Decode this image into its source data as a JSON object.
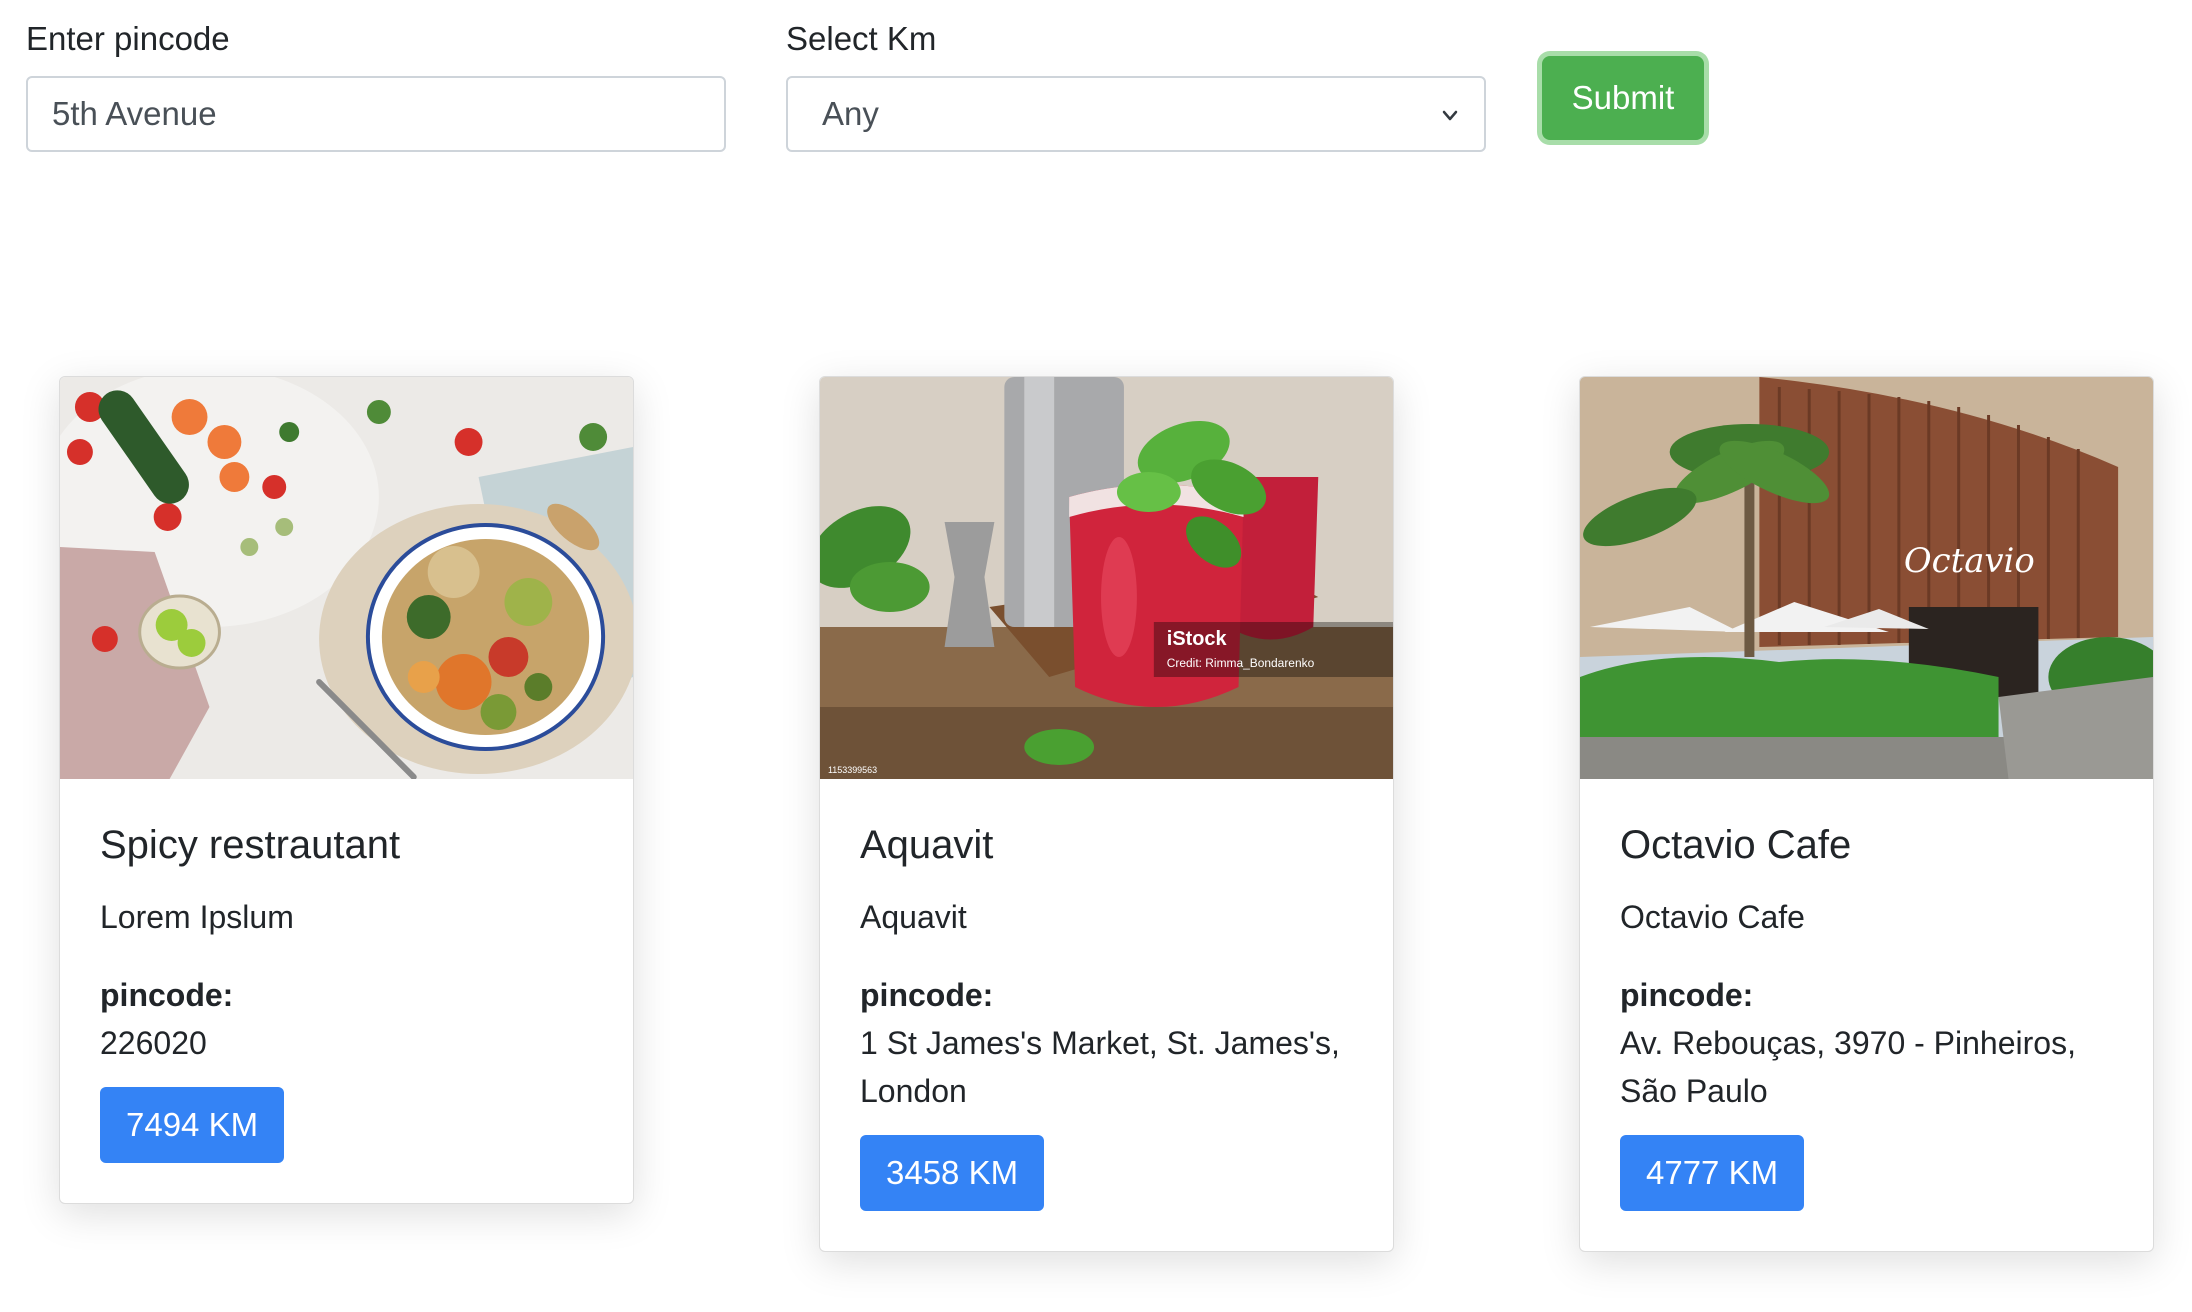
{
  "search": {
    "pincode_label": "Enter pincode",
    "pincode_value": "5th Avenue",
    "km_label": "Select Km",
    "km_selected": "Any",
    "submit_label": "Submit"
  },
  "colors": {
    "submit": "#4caf50",
    "km_badge": "#3483f5"
  },
  "restaurants": [
    {
      "name": "Spicy restrautant",
      "description": "Lorem Ipslum",
      "pincode_label": "pincode:",
      "pincode": "226020",
      "distance": "7494 KM",
      "image_icon": "food-bowl-photo"
    },
    {
      "name": "Aquavit",
      "description": "Aquavit",
      "pincode_label": "pincode:",
      "pincode": "1 St James's Market, St. James's, London",
      "distance": "3458 KM",
      "image_icon": "red-drink-photo",
      "image_watermark": "iStock",
      "image_credit": "Credit: Rimma_Bondarenko",
      "image_id": "1153399563"
    },
    {
      "name": "Octavio Cafe",
      "description": "Octavio Cafe",
      "pincode_label": "pincode:",
      "pincode": "Av. Rebouças, 3970 - Pinheiros, São Paulo",
      "distance": "4777 KM",
      "image_icon": "cafe-building-photo",
      "image_sign": "Octavio"
    }
  ]
}
